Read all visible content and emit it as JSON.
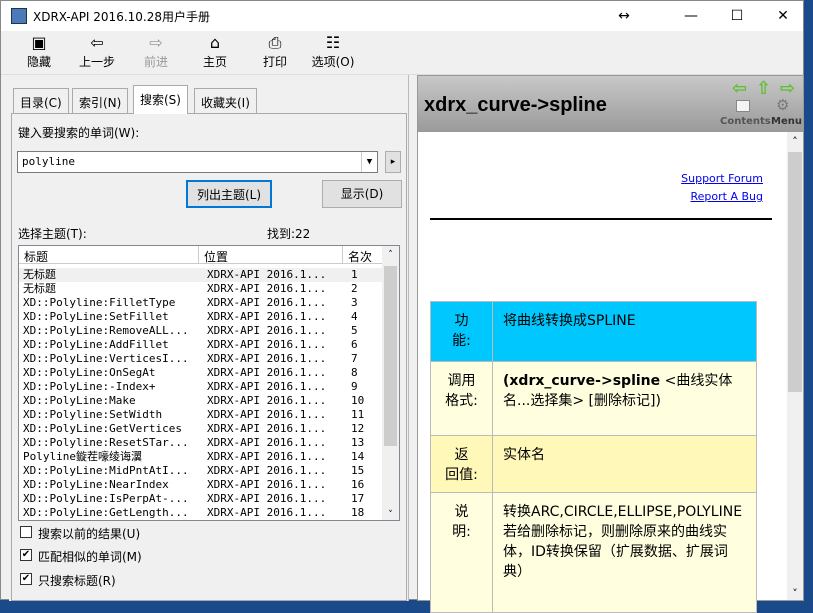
{
  "window": {
    "title": "XDRX-API 2016.10.28用户手册",
    "minimize": "—",
    "maximize": "☐",
    "close": "✕",
    "resize": "↔"
  },
  "toolbar": [
    {
      "label": "隐藏",
      "icon": "▣"
    },
    {
      "label": "上一步",
      "icon": "⇦"
    },
    {
      "label": "前进",
      "icon": "⇨",
      "disabled": true
    },
    {
      "label": "主页",
      "icon": "⌂"
    },
    {
      "label": "打印",
      "icon": "⎙"
    },
    {
      "label": "选项(O)",
      "icon": "☷"
    }
  ],
  "tabs": [
    {
      "label": "目录(C)"
    },
    {
      "label": "索引(N)"
    },
    {
      "label": "搜索(S)",
      "active": true
    },
    {
      "label": "收藏夹(I)"
    }
  ],
  "search": {
    "prompt": "键入要搜索的单词(W):",
    "value": "polyline",
    "list_topics": "列出主题(L)",
    "display": "显示(D)",
    "select_topic": "选择主题(T):",
    "found": "找到:22"
  },
  "columns": [
    "标题",
    "位置",
    "名次"
  ],
  "results": [
    [
      "无标题",
      "XDRX-API 2016.1...",
      "1"
    ],
    [
      "无标题",
      "XDRX-API 2016.1...",
      "2"
    ],
    [
      "XD::Polyline:FilletType",
      "XDRX-API 2016.1...",
      "3"
    ],
    [
      "XD::PolyLine:SetFillet",
      "XDRX-API 2016.1...",
      "4"
    ],
    [
      "XD::PolyLine:RemoveALL...",
      "XDRX-API 2016.1...",
      "5"
    ],
    [
      "XD::PolyLine:AddFillet",
      "XDRX-API 2016.1...",
      "6"
    ],
    [
      "XD::PolyLine:VerticesI...",
      "XDRX-API 2016.1...",
      "7"
    ],
    [
      "XD::PolyLine:OnSegAt",
      "XDRX-API 2016.1...",
      "8"
    ],
    [
      "XD::PolyLine:-Index+",
      "XDRX-API 2016.1...",
      "9"
    ],
    [
      "XD::PolyLine:Make",
      "XDRX-API 2016.1...",
      "10"
    ],
    [
      "XD::Polyline:SetWidth",
      "XDRX-API 2016.1...",
      "11"
    ],
    [
      "XD::PolyLine:GetVertices",
      "XDRX-API 2016.1...",
      "12"
    ],
    [
      "XD::Polyline:ResetSTar...",
      "XDRX-API 2016.1...",
      "13"
    ],
    [
      "Polyline鏇茬嚎绫诲瀷",
      "XDRX-API 2016.1...",
      "14"
    ],
    [
      "XD::PolyLine:MidPntAtI...",
      "XDRX-API 2016.1...",
      "15"
    ],
    [
      "XD::PolyLine:NearIndex",
      "XDRX-API 2016.1...",
      "16"
    ],
    [
      "XD::PolyLine:IsPerpAt-...",
      "XDRX-API 2016.1...",
      "17"
    ],
    [
      "XD::PolyLine:GetLength...",
      "XDRX-API 2016.1...",
      "18"
    ]
  ],
  "options": [
    {
      "label": "搜索以前的结果(U)",
      "checked": false
    },
    {
      "label": "匹配相似的单词(M)",
      "checked": true
    },
    {
      "label": "只搜索标题(R)",
      "checked": true
    }
  ],
  "topic": {
    "title": "xdrx_curve->spline",
    "contents": "Contents",
    "menu": "Menu",
    "support": "Support Forum",
    "bug": "Report A Bug",
    "rows": [
      {
        "label": "功　能:",
        "value": "将曲线转换成SPLINE",
        "color": "#00c8ff"
      },
      {
        "label": "调用格式:",
        "bold": "(xdrx_curve->spline",
        "value": " <曲线实体名...选择集> [删除标记])",
        "color": "#ffffe0"
      },
      {
        "label": "返　回值:",
        "value": "实体名",
        "color": "#fff8b8"
      },
      {
        "label": "说　明:",
        "value": "转换ARC,CIRCLE,ELLIPSE,POLYLINE若给删除标记，则删除原来的曲线实体，ID转换保留（扩展数据、扩展词典）",
        "color": "#ffffe0"
      }
    ]
  }
}
